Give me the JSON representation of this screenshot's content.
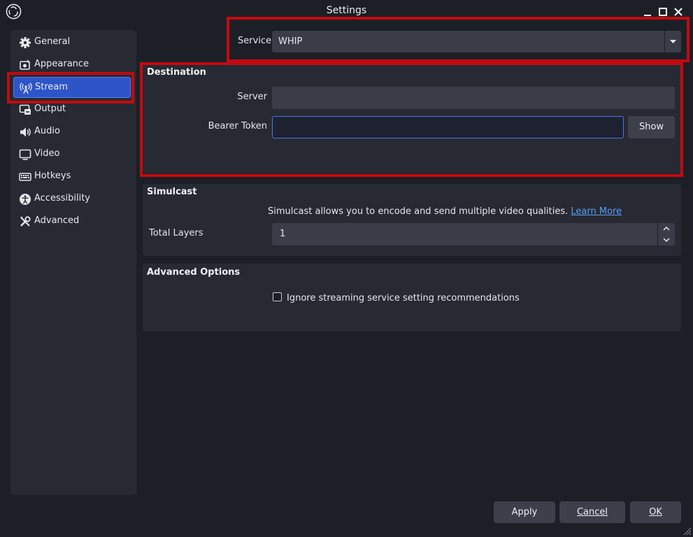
{
  "window": {
    "title": "Settings",
    "minimize": "–",
    "maximize": "□",
    "close": "✕"
  },
  "sidebar": {
    "items": [
      {
        "label": "General",
        "icon": "gear-icon",
        "active": false
      },
      {
        "label": "Appearance",
        "icon": "appearance-icon",
        "active": false
      },
      {
        "label": "Stream",
        "icon": "antenna-icon",
        "active": true
      },
      {
        "label": "Output",
        "icon": "output-icon",
        "active": false
      },
      {
        "label": "Audio",
        "icon": "speaker-icon",
        "active": false
      },
      {
        "label": "Video",
        "icon": "monitor-icon",
        "active": false
      },
      {
        "label": "Hotkeys",
        "icon": "keyboard-icon",
        "active": false
      },
      {
        "label": "Accessibility",
        "icon": "accessibility-icon",
        "active": false
      },
      {
        "label": "Advanced",
        "icon": "tools-icon",
        "active": false
      }
    ]
  },
  "service": {
    "label": "Service",
    "value": "WHIP"
  },
  "destination": {
    "title": "Destination",
    "server_label": "Server",
    "server_value": "",
    "token_label": "Bearer Token",
    "token_value": "",
    "show_button": "Show"
  },
  "simulcast": {
    "title": "Simulcast",
    "description": "Simulcast allows you to encode and send multiple video qualities.",
    "learn_more": "Learn More",
    "layers_label": "Total Layers",
    "layers_value": "1"
  },
  "advanced_options": {
    "title": "Advanced Options",
    "ignore_label": "Ignore streaming service setting recommendations",
    "ignore_checked": false
  },
  "buttons": {
    "apply": "Apply",
    "cancel": "Cancel",
    "ok": "OK"
  },
  "colors": {
    "accent": "#2d55c8",
    "highlight": "#c30a10",
    "link": "#5a9df5",
    "panel": "#272a33",
    "background": "#1d1f26"
  }
}
